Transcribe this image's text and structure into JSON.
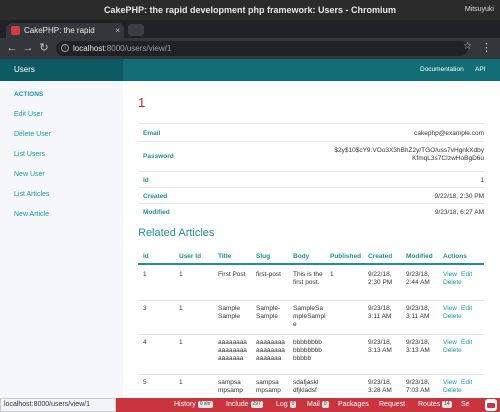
{
  "window": {
    "title": "CakePHP: the rapid development php framework: Users - Chromium",
    "user": "Mitsuyuki"
  },
  "browser": {
    "tab_title": "CakePHP: the rapid",
    "tab_close": "×",
    "url_host": "localhost",
    "url_path": ":8000/users/view/1",
    "back": "←",
    "forward": "→",
    "reload": "↻",
    "star": "☆",
    "menu": "⋮",
    "info": "i"
  },
  "appbar": {
    "brand": "Users",
    "nav": [
      "Documentation",
      "API"
    ]
  },
  "sidebar": {
    "heading": "ACTIONS",
    "links": [
      "Edit User",
      "Delete User",
      "List Users",
      "New User",
      "List Articles",
      "New Article"
    ]
  },
  "user": {
    "id_heading": "1",
    "fields": [
      {
        "label": "Email",
        "value": "cakephp@example.com"
      },
      {
        "label": "Password",
        "value": "$2y$10$cY9.VOo3X3hBhZ2y/TGO/uss7vHgnkXdbyKfmqL3s7CIzwHoBgD6u"
      },
      {
        "label": "Id",
        "value": "1"
      },
      {
        "label": "Created",
        "value": "9/22/18, 2:30 PM"
      },
      {
        "label": "Modified",
        "value": "9/23/18, 6:27 AM"
      }
    ]
  },
  "related": {
    "title": "Related Articles",
    "columns": [
      "Id",
      "User Id",
      "Title",
      "Slug",
      "Body",
      "Published",
      "Created",
      "Modified",
      "Actions"
    ],
    "rows": [
      {
        "id": "1",
        "user_id": "1",
        "title": "First Post",
        "slug": "first-post",
        "body": "This is the first post.",
        "published": "1",
        "created": "9/22/18, 2:30 PM",
        "modified": "9/23/18, 2:44 AM"
      },
      {
        "id": "3",
        "user_id": "1",
        "title": "Sample Sample",
        "slug": "Sample-Sample",
        "body": "SampleSampleSample",
        "published": "",
        "created": "9/23/18, 3:11 AM",
        "modified": "9/23/18, 3:11 AM"
      },
      {
        "id": "4",
        "user_id": "1",
        "title": "aaaaaaaaaaaaaaaaaaaaaaa",
        "slug": "aaaaaaaaaaaaaaaaaaaaaaa",
        "body": "bbbbbbbbbbbbbbbbbbbbb",
        "published": "",
        "created": "9/23/18, 3:13 AM",
        "modified": "9/23/18, 3:13 AM"
      },
      {
        "id": "5",
        "user_id": "1",
        "title": "sampsa mpsamp",
        "slug": "sampsa mpsamp",
        "body": "sdafjaskl dfjkladsf",
        "published": "",
        "created": "9/23/18, 3:28 AM",
        "modified": "9/23/18, 7:03 AM"
      }
    ],
    "action_view": "View",
    "action_edit": "Edit",
    "action_delete": "Delete"
  },
  "status_url": "localhost:8000/users/view/1",
  "debugkit": {
    "panels": [
      {
        "label": "History",
        "badge": "0 xhr"
      },
      {
        "label": "Include",
        "badge": "297"
      },
      {
        "label": "Log",
        "badge": "0"
      },
      {
        "label": "Mail",
        "badge": "0"
      },
      {
        "label": "Packages",
        "badge": ""
      },
      {
        "label": "Request",
        "badge": ""
      },
      {
        "label": "Routes",
        "badge": "14"
      },
      {
        "label": "Se",
        "badge": ""
      }
    ]
  },
  "colors": {
    "accent": "#1e8f9b",
    "appbar": "#116d76",
    "id_red": "#c3232d",
    "debugbar": "#c9353e"
  }
}
